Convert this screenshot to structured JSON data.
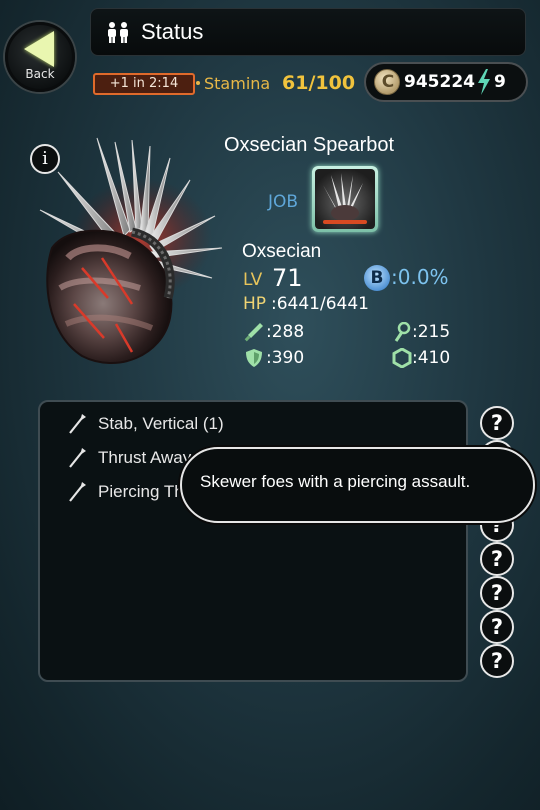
{
  "header": {
    "back_label": "Back",
    "title": "Status"
  },
  "resources": {
    "stamina_timer": "+1 in 2:14",
    "stamina_label": "Stamina",
    "stamina_value": "61/100",
    "coins": "945224",
    "energy": "9"
  },
  "character": {
    "name": "Oxsecian Spearbot",
    "job_label": "JOB",
    "race": "Oxsecian",
    "level_label": "LV",
    "level": "71",
    "b_label": "B",
    "b_value": ":0.0%",
    "hp_label": "HP",
    "hp_value": ":6441/6441",
    "stats": {
      "attack": ":288",
      "magic": ":215",
      "defense": ":390",
      "resistance": ":410"
    }
  },
  "skills": [
    {
      "label": "Stab, Vertical (1)"
    },
    {
      "label": "Thrust Away, Vertical (1)"
    },
    {
      "label": "Piercing Thrust, Vertical (2)"
    }
  ],
  "help_glyph": "?",
  "info_glyph": "i",
  "coin_glyph": "C",
  "tooltip": {
    "text": "Skewer foes with a piercing assault."
  },
  "colors": {
    "accent_gold": "#e8b847",
    "accent_blue": "#5fa6d8",
    "timer_orange": "#e06a2b"
  }
}
